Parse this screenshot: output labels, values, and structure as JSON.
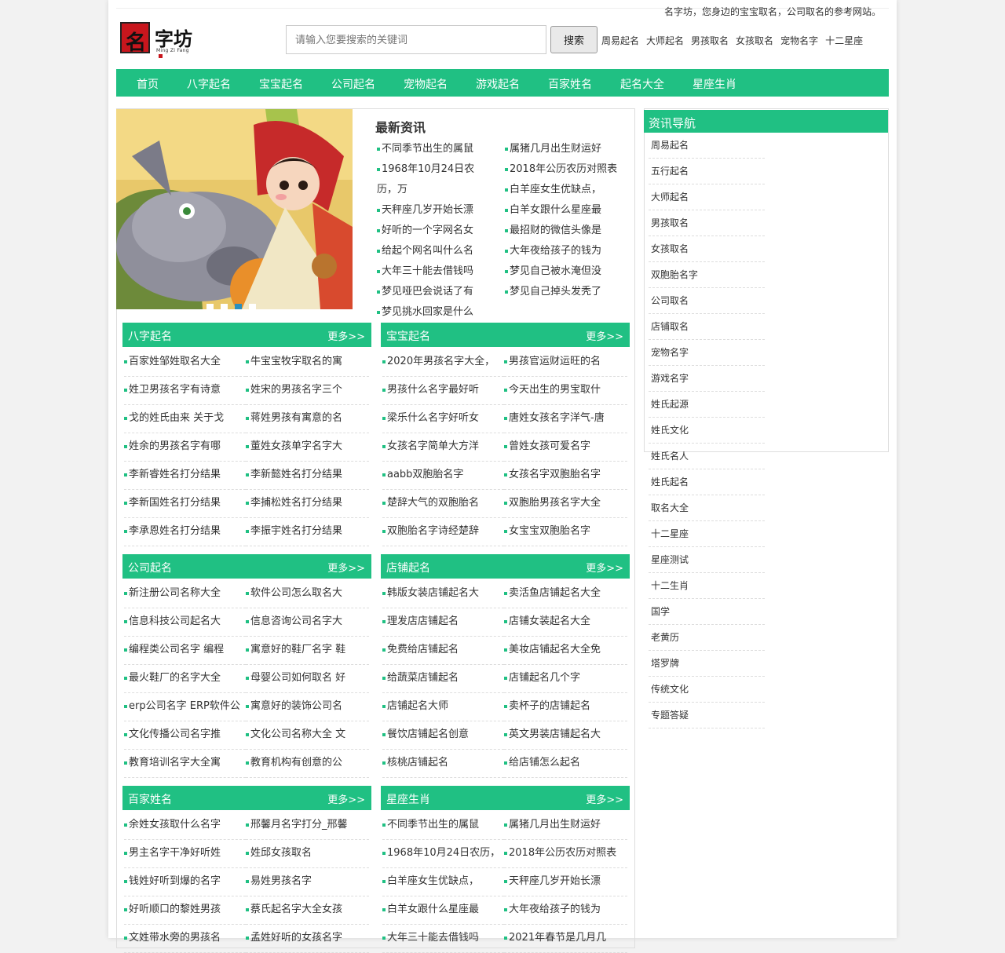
{
  "tagline": "名字坊，您身边的宝宝取名，公司取名的参考网站。",
  "logo": {
    "char": "名",
    "text": "字坊",
    "sub": "Ming Zi Fang"
  },
  "search": {
    "placeholder": "请输入您要搜索的关键词",
    "button": "搜索"
  },
  "quick_links": [
    "周易起名",
    "大师起名",
    "男孩取名",
    "女孩取名",
    "宠物名字",
    "十二星座"
  ],
  "nav": [
    "首页",
    "八字起名",
    "宝宝起名",
    "公司起名",
    "宠物起名",
    "游戏起名",
    "百家姓名",
    "起名大全",
    "星座生肖"
  ],
  "news": {
    "title": "最新资讯",
    "items": [
      "不同季节出生的属鼠",
      "属猪几月出生财运好",
      "1968年10月24日农历，万",
      "2018年公历农历对照表",
      "白羊座女生优缺点，",
      "天秤座几岁开始长漂",
      "白羊女跟什么星座最",
      "好听的一个字网名女",
      "最招财的微信头像是",
      "给起个网名叫什么名",
      "大年夜给孩子的钱为",
      "大年三十能去借钱吗",
      "梦见自己被水淹但没",
      "梦见哑巴会说话了有",
      "梦见自己掉头发秃了",
      "梦见挑水回家是什么"
    ]
  },
  "more_label": "更多>>",
  "sections": [
    {
      "title": "八字起名",
      "items": [
        "百家姓邹姓取名大全",
        "牛宝宝牧字取名的寓",
        "姓卫男孩名字有诗意",
        "姓宋的男孩名字三个",
        "戈的姓氏由来 关于戈",
        "蒋姓男孩有寓意的名",
        "姓余的男孩名字有哪",
        "董姓女孩单字名字大",
        "李新睿姓名打分结果",
        "李新懿姓名打分结果",
        "李新国姓名打分结果",
        "李捕松姓名打分结果",
        "李承恩姓名打分结果",
        "李振宇姓名打分结果"
      ]
    },
    {
      "title": "宝宝起名",
      "items": [
        "2020年男孩名字大全，",
        "男孩官运财运旺的名",
        "男孩什么名字最好听",
        "今天出生的男宝取什",
        "梁乐什么名字好听女",
        "唐姓女孩名字洋气-唐",
        "女孩名字简单大方洋",
        "曾姓女孩可爱名字",
        "aabb双胞胎名字",
        "女孩名字双胞胎名字",
        "楚辞大气的双胞胎名",
        "双胞胎男孩名字大全",
        "双胞胎名字诗经楚辞",
        "女宝宝双胞胎名字"
      ]
    },
    {
      "title": "公司起名",
      "items": [
        "新注册公司名称大全",
        "软件公司怎么取名大",
        "信息科技公司起名大",
        "信息咨询公司名字大",
        "编程类公司名字 编程",
        "寓意好的鞋厂名字 鞋",
        "最火鞋厂的名字大全",
        "母婴公司如何取名 好",
        "erp公司名字 ERP软件公",
        "寓意好的装饰公司名",
        "文化传播公司名字推",
        "文化公司名称大全 文",
        "教育培训名字大全寓",
        "教育机构有创意的公"
      ]
    },
    {
      "title": "店铺起名",
      "items": [
        "韩版女装店铺起名大",
        "卖活鱼店铺起名大全",
        "理发店店铺起名",
        "店铺女装起名大全",
        "免费给店铺起名",
        "美妆店铺起名大全免",
        "给蔬菜店铺起名",
        "店铺起名几个字",
        "店铺起名大师",
        "卖杯子的店铺起名",
        "餐饮店铺起名创意",
        "英文男装店铺起名大",
        "核桃店铺起名",
        "给店铺怎么起名"
      ]
    },
    {
      "title": "百家姓名",
      "items": [
        "余姓女孩取什么名字",
        "邢馨月名字打分_邢馨",
        "男主名字干净好听姓",
        "姓邱女孩取名",
        "钱姓好听到爆的名字",
        "易姓男孩名字",
        "好听顺口的黎姓男孩",
        "蔡氏起名字大全女孩",
        "文姓带水旁的男孩名",
        "孟姓好听的女孩名字"
      ]
    },
    {
      "title": "星座生肖",
      "items": [
        "不同季节出生的属鼠",
        "属猪几月出生财运好",
        "1968年10月24日农历，",
        "2018年公历农历对照表",
        "白羊座女生优缺点，",
        "天秤座几岁开始长漂",
        "白羊女跟什么星座最",
        "大年夜给孩子的钱为",
        "大年三十能去借钱吗",
        "2021年春节是几月几"
      ]
    }
  ],
  "sidebar": {
    "title": "资讯导航",
    "items": [
      "周易起名",
      "五行起名",
      "大师起名",
      "男孩取名",
      "女孩取名",
      "双胞胎名字",
      "公司取名",
      "店铺取名",
      "宠物名字",
      "游戏名字",
      "姓氏起源",
      "姓氏文化",
      "姓氏名人",
      "姓氏起名",
      "取名大全",
      "十二星座",
      "星座测试",
      "十二生肖",
      "国学",
      "老黄历",
      "塔罗牌",
      "传统文化",
      "专题答疑"
    ]
  },
  "colors": {
    "accent": "#20c083",
    "logo_red": "#c8161d",
    "dot_active": "#2a8fbd"
  }
}
